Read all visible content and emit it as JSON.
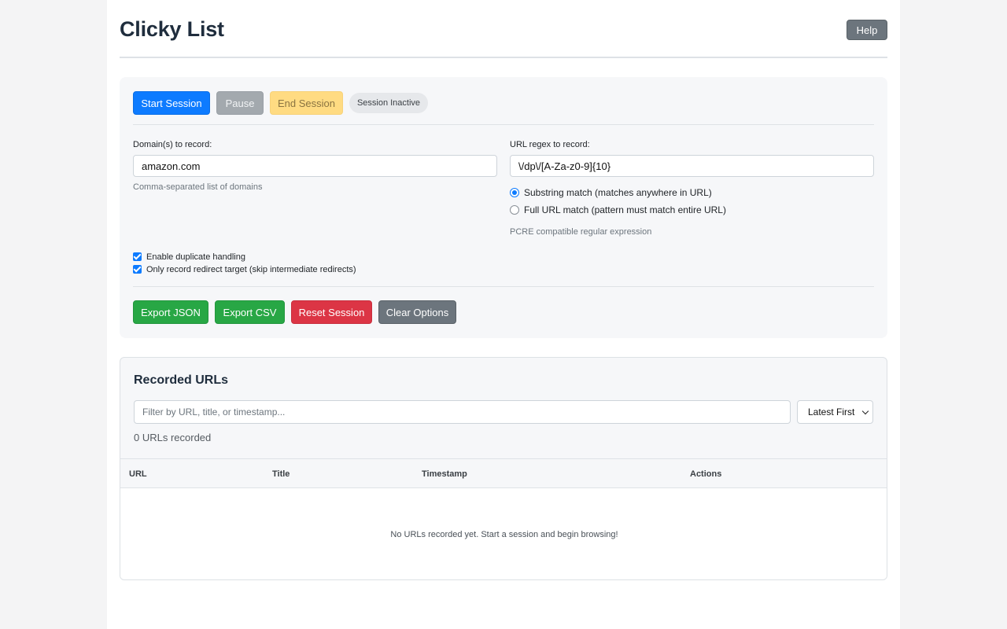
{
  "header": {
    "title": "Clicky List",
    "help_label": "Help"
  },
  "session": {
    "start_label": "Start Session",
    "pause_label": "Pause",
    "end_label": "End Session",
    "status": "Session Inactive"
  },
  "domains": {
    "label": "Domain(s) to record:",
    "value": "amazon.com",
    "hint": "Comma-separated list of domains"
  },
  "regex": {
    "label": "URL regex to record:",
    "value": "\\/dp\\/[A-Za-z0-9]{10}",
    "options": [
      {
        "label": "Substring match (matches anywhere in URL)",
        "checked": true
      },
      {
        "label": "Full URL match (pattern must match entire URL)",
        "checked": false
      }
    ],
    "hint": "PCRE compatible regular expression"
  },
  "options": {
    "duplicate_label": "Enable duplicate handling",
    "redirect_label": "Only record redirect target (skip intermediate redirects)"
  },
  "actions": {
    "export_json": "Export JSON",
    "export_csv": "Export CSV",
    "reset": "Reset Session",
    "clear": "Clear Options"
  },
  "records": {
    "title": "Recorded URLs",
    "filter_placeholder": "Filter by URL, title, or timestamp...",
    "sort_value": "Latest First",
    "count": "0 URLs recorded",
    "columns": [
      "URL",
      "Title",
      "Timestamp",
      "Actions"
    ],
    "empty_message": "No URLs recorded yet. Start a session and begin browsing!"
  },
  "colors": {
    "primary": "#0d7bff",
    "success": "#28a745",
    "danger": "#dc3545",
    "secondary": "#6c757d",
    "warning": "#ffdb82"
  }
}
